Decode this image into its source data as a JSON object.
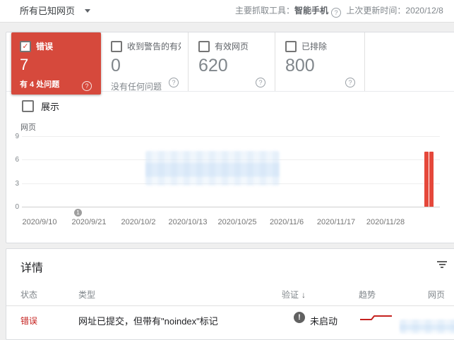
{
  "topbar": {
    "scope": "所有已知网页",
    "crawler_label": "主要抓取工具：",
    "crawler_value": "智能手机",
    "updated_label": "上次更新时间：",
    "updated_value": "2020/12/8"
  },
  "icons": {
    "caret_down": "▼",
    "help": "?",
    "check": "✓",
    "sort_down": "↓",
    "exclamation": "!",
    "marker": "1"
  },
  "cards": [
    {
      "label": "错误",
      "value": "7",
      "note": "有 4 处问题",
      "checked": true,
      "accent": "#d6493c"
    },
    {
      "label": "收到警告的有效…",
      "value": "0",
      "note": "没有任何问题",
      "checked": false
    },
    {
      "label": "有效网页",
      "value": "620",
      "note": "",
      "checked": false
    },
    {
      "label": "已排除",
      "value": "800",
      "note": "",
      "checked": false
    }
  ],
  "show_checkbox": {
    "label": "展示",
    "checked": false
  },
  "chart_data": {
    "type": "bar",
    "title": "",
    "xlabel": "",
    "ylabel": "网页",
    "ylim": [
      0,
      9
    ],
    "yticks": [
      "9",
      "6",
      "3",
      "0"
    ],
    "grid": true,
    "x_tick_labels": [
      "2020/9/10",
      "2020/9/21",
      "2020/10/2",
      "2020/10/13",
      "2020/10/25",
      "2020/11/6",
      "2020/11/17",
      "2020/11/28"
    ],
    "series": [
      {
        "name": "错误",
        "color": "#e5483b",
        "points": [
          {
            "x_fraction": 0.963,
            "y": 7
          },
          {
            "x_fraction": 0.975,
            "y": 7
          }
        ]
      }
    ],
    "axis_marker": {
      "label": "1",
      "near_tick": "2020/9/21"
    },
    "redacted_regions": [
      "plot-center-watermark"
    ]
  },
  "details": {
    "title": "详情",
    "columns": [
      {
        "label": "状态"
      },
      {
        "label": "类型"
      },
      {
        "label": "验证",
        "sorted": "desc"
      },
      {
        "label": "趋势"
      },
      {
        "label": "网页"
      }
    ],
    "rows": [
      {
        "status": "错误",
        "type": "网址已提交，但带有\"noindex\"标记",
        "validation": "未启动",
        "trend_spark": [
          0,
          0,
          0,
          1,
          1,
          1,
          1
        ],
        "trend_color": "#c5221f",
        "pages": ""
      }
    ],
    "redacted_regions": [
      "pages-cell"
    ]
  }
}
